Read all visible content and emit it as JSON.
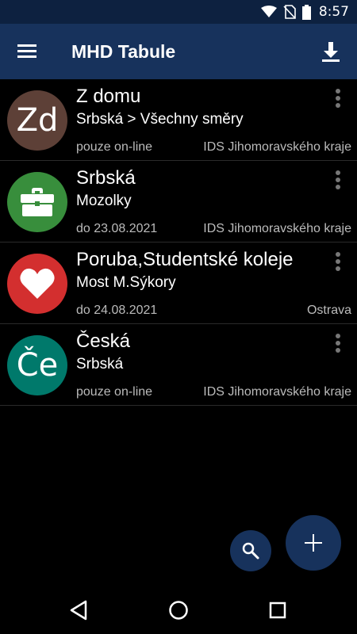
{
  "status_bar": {
    "time": "8:57",
    "icons": [
      "wifi-icon",
      "no-sim-icon",
      "battery-icon"
    ]
  },
  "app_bar": {
    "title": "MHD Tabule",
    "menu_icon": "hamburger-menu-icon",
    "action_icon": "download-icon"
  },
  "colors": {
    "app_bar": "#17325c",
    "status_bar": "#0d2140",
    "background": "#000000",
    "avatar_brown": "#5d4037",
    "avatar_green": "#388e3c",
    "avatar_red": "#d32f2f",
    "avatar_teal": "#00796b"
  },
  "items": [
    {
      "avatar_text": "Zd",
      "avatar_color": "#5d4037",
      "title": "Z domu",
      "subtitle": "Srbská > Všechny směry",
      "left_info": "pouze on-line",
      "right_info": "IDS Jihomoravského kraje"
    },
    {
      "avatar_icon": "briefcase-icon",
      "avatar_color": "#388e3c",
      "title": "Srbská",
      "subtitle": "Mozolky",
      "left_info": "do 23.08.2021",
      "right_info": "IDS Jihomoravského kraje"
    },
    {
      "avatar_icon": "heart-icon",
      "avatar_color": "#d32f2f",
      "title": "Poruba,Studentské koleje",
      "subtitle": "Most M.Sýkory",
      "left_info": "do 24.08.2021",
      "right_info": "Ostrava"
    },
    {
      "avatar_text": "Če",
      "avatar_color": "#00796b",
      "title": "Česká",
      "subtitle": "Srbská",
      "left_info": "pouze on-line",
      "right_info": "IDS Jihomoravského kraje"
    }
  ],
  "fabs": {
    "search_icon": "search-icon",
    "add_icon": "plus-icon"
  },
  "nav_bar": {
    "icons": [
      "back-icon",
      "home-icon",
      "recents-icon"
    ]
  }
}
